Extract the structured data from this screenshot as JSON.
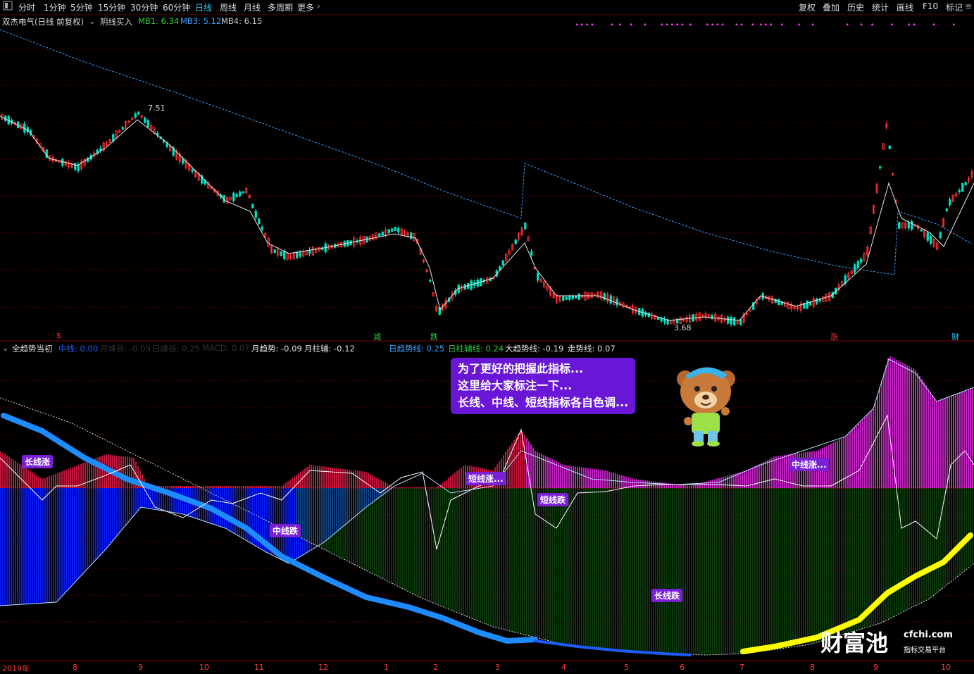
{
  "toolbar": {
    "left_icon": "window-icon",
    "periods": [
      "分时",
      "1分钟",
      "5分钟",
      "15分钟",
      "30分钟",
      "60分钟",
      "日线",
      "周线",
      "月线",
      "多周期",
      "更多"
    ],
    "active_period": "日线",
    "more_icon": "chevron-right-icon",
    "right_buttons": [
      "复权",
      "叠加",
      "历史",
      "统计",
      "画线",
      "F10",
      "标记"
    ],
    "menu_icon": "menu-icon"
  },
  "price_panel": {
    "title": "双杰电气(日线 前复权)",
    "dropdown_icon": "chevron-down-icon",
    "indicator_name": "阴线买入",
    "mb1_label": "MB1: 6.34",
    "mb3_label": "MB3: 5.12",
    "mb4_label": "MB4: 6.15",
    "high_label": "7.51",
    "low_label": "3.68",
    "signals": [
      {
        "text": "$",
        "color": "#ff3030"
      },
      {
        "text": "减",
        "color": "#2ecc40"
      },
      {
        "text": "跌",
        "color": "#2ecc40"
      },
      {
        "text": "涨",
        "color": "#ff3030"
      },
      {
        "text": "财",
        "color": "#39c6ff"
      }
    ],
    "colors": {
      "up": "#ff3030",
      "down": "#00e0c0",
      "ma": "#e8e8e8",
      "long_ma": "#3aa0ff"
    }
  },
  "indicator_panel": {
    "name": "全趋势当初",
    "items": [
      {
        "label": "中线: 0.00",
        "color": "#1e5cff"
      },
      {
        "label": "月峰谷: -0.09",
        "color": "#333333"
      },
      {
        "label": "日峰谷: 0.25",
        "color": "#333333"
      },
      {
        "label": "MACD: 0.07",
        "color": "#333333"
      },
      {
        "label": "月趋势: -0.09",
        "color": "#e0e0e0"
      },
      {
        "label": "月柱辅: -0.12",
        "color": "#e0e0e0"
      },
      {
        "label": "日趋势线: 0.25",
        "color": "#3aa0ff"
      },
      {
        "label": "日柱辅线: 0.24",
        "color": "#2ecc40"
      },
      {
        "label": "大趋势线: -0.19",
        "color": "#e0e0e0"
      },
      {
        "label": "走势线: 0.07",
        "color": "#e0e0e0"
      }
    ],
    "tags": [
      "长线涨",
      "中线跌",
      "短线涨...",
      "短线跌",
      "中线涨...",
      "长线跌"
    ],
    "annotation": [
      "为了更好的把握此指标...",
      "这里给大家标注一下...",
      "长线、中线、短线指标各自色调..."
    ]
  },
  "time_axis": [
    "2019年",
    "8",
    "9",
    "10",
    "11",
    "12",
    "1",
    "2",
    "3",
    "4",
    "5",
    "6",
    "7",
    "8",
    "9",
    "10"
  ],
  "watermark": {
    "brand": "财富池",
    "site": "cfchi.com",
    "slogan": "指标交易平台"
  }
}
